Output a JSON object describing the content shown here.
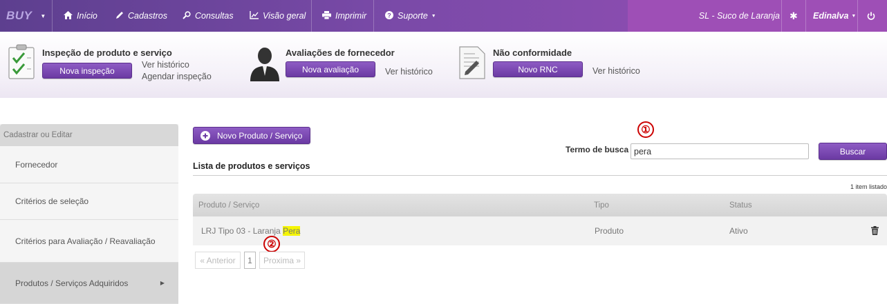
{
  "navbar": {
    "logo": "BUY",
    "items": [
      {
        "icon": "home-icon",
        "label": "Início"
      },
      {
        "icon": "pencil-icon",
        "label": "Cadastros"
      },
      {
        "icon": "search-icon",
        "label": "Consultas"
      },
      {
        "icon": "chart-icon",
        "label": "Visão geral"
      },
      {
        "icon": "printer-icon",
        "label": "Imprimir"
      },
      {
        "icon": "help-icon",
        "label": "Suporte"
      }
    ],
    "company": "SL - Suco de Laranja",
    "user": "Edinalva",
    "settings_icon": "gear-icon",
    "logout_icon": "power-icon"
  },
  "quick_actions": {
    "inspection": {
      "title": "Inspeção de produto e serviço",
      "button": "Nova inspeção",
      "links": [
        "Ver histórico",
        "Agendar inspeção"
      ]
    },
    "supplier": {
      "title": "Avaliações de fornecedor",
      "button": "Nova avaliação",
      "links": [
        "Ver histórico"
      ]
    },
    "nonconformity": {
      "title": "Não conformidade",
      "button": "Novo RNC",
      "links": [
        "Ver histórico"
      ]
    }
  },
  "sidebar": {
    "header": "Cadastrar ou Editar",
    "items": [
      {
        "label": "Fornecedor",
        "active": false
      },
      {
        "label": "Critérios de seleção",
        "active": false
      },
      {
        "label": "Critérios para Avaliação / Reavaliação",
        "active": false
      },
      {
        "label": "Produtos / Serviços Adquiridos",
        "active": true
      }
    ]
  },
  "main": {
    "new_button": "Novo Produto / Serviço",
    "search_label": "Termo de busca",
    "search_value": "pera",
    "search_button": "Buscar",
    "list_title": "Lista de produtos e serviços",
    "count_text": "1 item listado",
    "columns": [
      "Produto / Serviço",
      "Tipo",
      "Status"
    ],
    "rows": [
      {
        "name_prefix": "LRJ Tipo 03 - Laranja ",
        "name_highlight": "Pera",
        "type": "Produto",
        "status": "Ativo"
      }
    ],
    "pagination": {
      "prev": "« Anterior",
      "page": "1",
      "next": "Proxima »"
    }
  },
  "annotations": [
    "①",
    "②"
  ],
  "colors": {
    "accent": "#7a4aa8",
    "highlight": "#f5f500",
    "callout": "#cc0000"
  }
}
